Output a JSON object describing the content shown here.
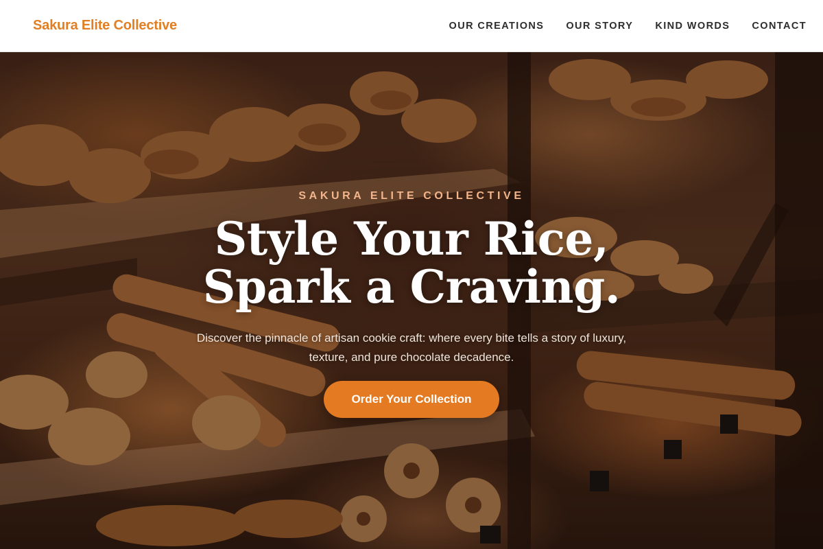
{
  "header": {
    "brand": "Sakura Elite Collective",
    "nav": [
      {
        "label": "OUR CREATIONS"
      },
      {
        "label": "OUR STORY"
      },
      {
        "label": "KIND WORDS"
      },
      {
        "label": "CONTACT"
      }
    ]
  },
  "hero": {
    "eyebrow": "SAKURA ELITE COLLECTIVE",
    "headline_line1": "Style Your Rice,",
    "headline_line2": "Spark a Craving.",
    "subhead": "Discover the pinnacle of artisan cookie craft: where every bite tells a story of luxury, texture, and pure chocolate decadence.",
    "cta_label": "Order Your Collection",
    "background_image": "bakery-display-case"
  },
  "colors": {
    "brand": "#e07f24",
    "cta": "#e47a22",
    "eyebrow": "#f2b58c",
    "nav_text": "#2c2c2c"
  }
}
